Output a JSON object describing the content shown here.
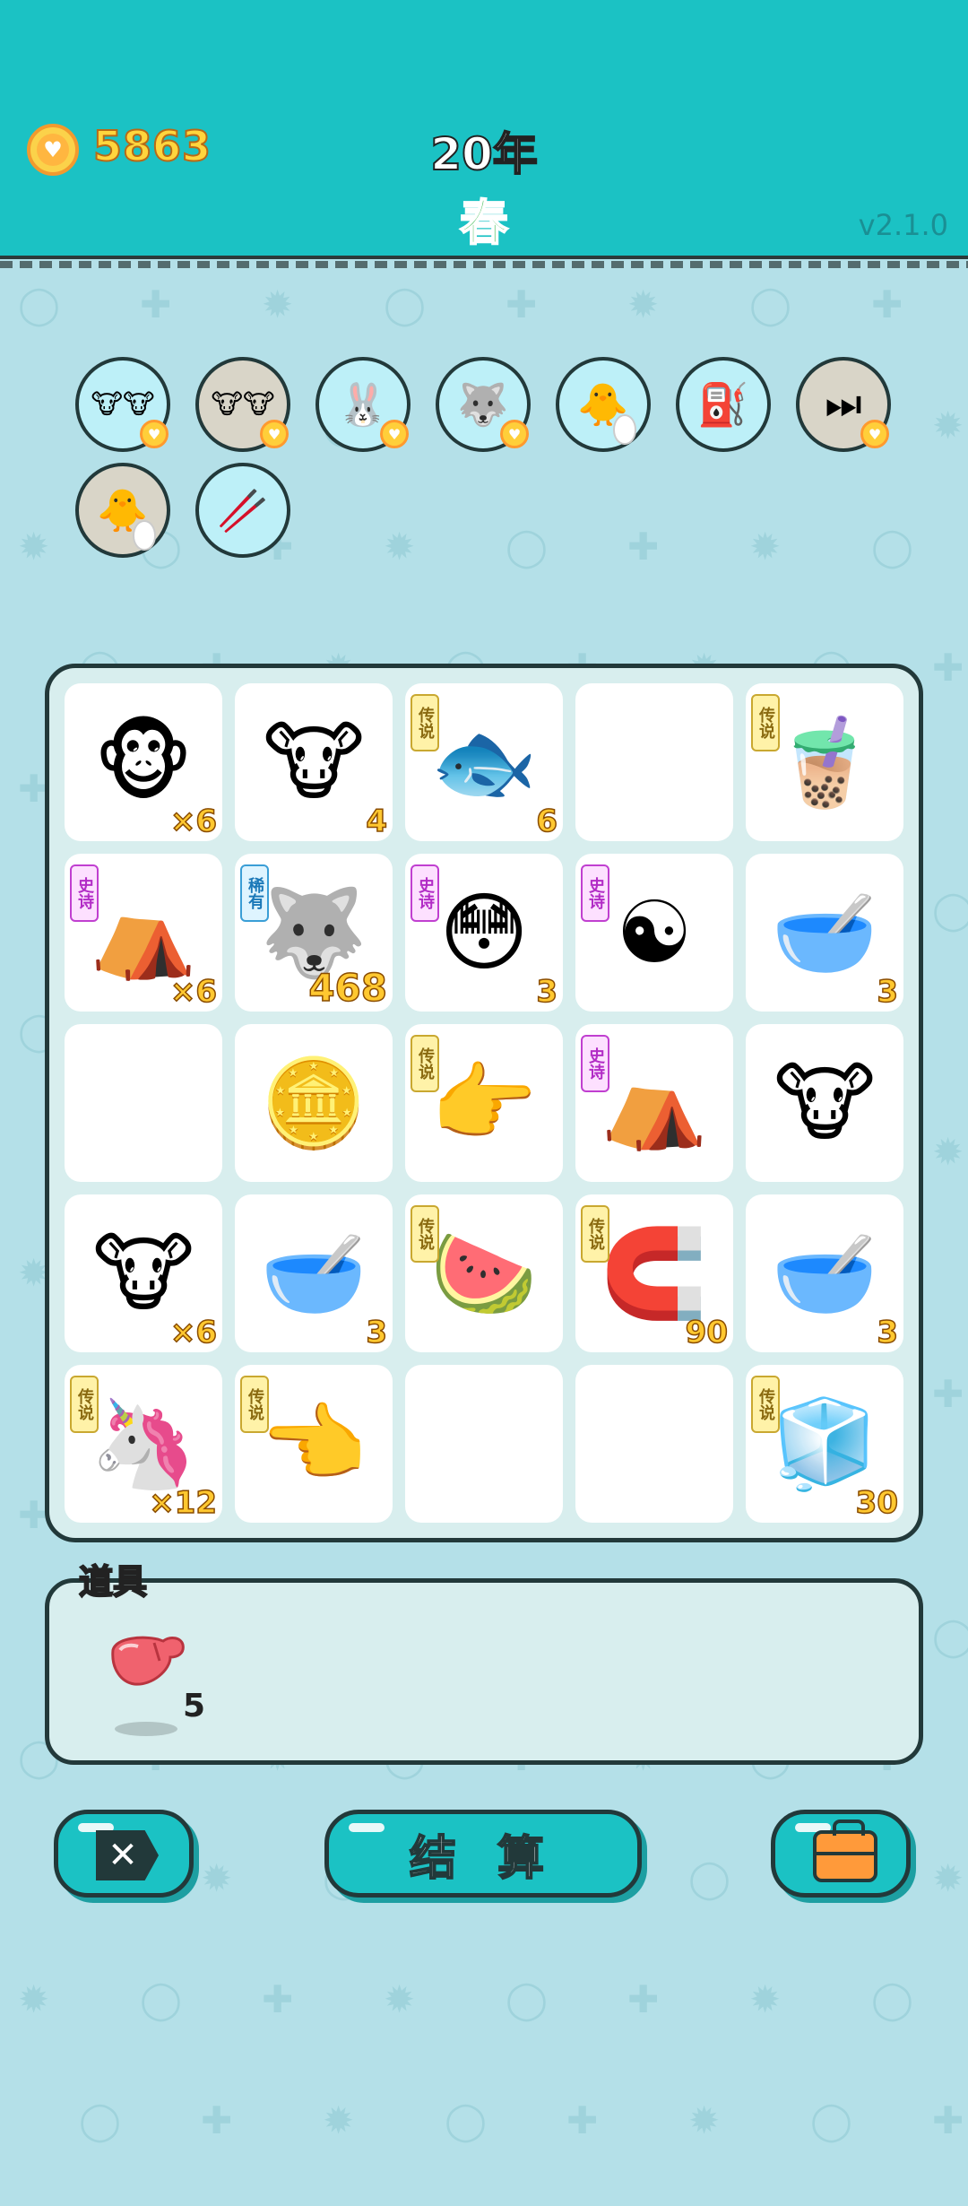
{
  "header": {
    "coins": "5863",
    "year": "20年",
    "season": "春",
    "version": "v2.1.0",
    "colors": {
      "bar": "#1bc2c4",
      "coin_text": "#ffd53d",
      "season_text": "#37b84a"
    }
  },
  "pets": [
    {
      "icon": "two-cows-icon",
      "glyph": "🐮🐮",
      "bg": "cyan",
      "badge": true
    },
    {
      "icon": "two-cows-icon",
      "glyph": "🐮🐮",
      "bg": "beige",
      "badge": true
    },
    {
      "icon": "rabbit-icon",
      "glyph": "🐰",
      "bg": "cyan",
      "badge": true
    },
    {
      "icon": "husky-icon",
      "glyph": "🐺",
      "bg": "cyan",
      "badge": true
    },
    {
      "icon": "chick-egg-icon",
      "glyph": "🐥",
      "bg": "cyan",
      "egg": true
    },
    {
      "icon": "air-pump-icon",
      "glyph": "⛽",
      "bg": "cyan"
    },
    {
      "icon": "skip-forward-icon",
      "glyph": "⏭",
      "bg": "beige",
      "badge": true
    },
    {
      "icon": "chick-egg-icon",
      "glyph": "🐥",
      "bg": "beige",
      "egg": true
    },
    {
      "icon": "chopsticks-icon",
      "glyph": "🥢",
      "bg": "cyan"
    }
  ],
  "board": [
    {
      "item": "monkey-icon",
      "glyph": "🐵",
      "count": "×6"
    },
    {
      "item": "cow-icon",
      "glyph": "🐮",
      "count": "4"
    },
    {
      "item": "koi-fish-icon",
      "glyph": "🐟",
      "tag": "传说",
      "tagType": "legend",
      "count": "6"
    },
    {
      "item": "empty"
    },
    {
      "item": "bubble-tea-icon",
      "glyph": "🧋",
      "tag": "传说",
      "tagType": "legend"
    },
    {
      "item": "rabbit-tent-icon",
      "glyph": "⛺",
      "tag": "史诗",
      "tagType": "epic",
      "count": "×6"
    },
    {
      "item": "husky-icon",
      "glyph": "🐺",
      "tag": "稀有",
      "tagType": "rare",
      "count": "468",
      "big": true
    },
    {
      "item": "yellow-face-icon",
      "glyph": "😳",
      "tag": "史诗",
      "tagType": "epic",
      "count": "3"
    },
    {
      "item": "bagua-icon",
      "glyph": "☯",
      "tag": "史诗",
      "tagType": "epic"
    },
    {
      "item": "soup-bowl-icon",
      "glyph": "🥣",
      "count": "3"
    },
    {
      "item": "empty"
    },
    {
      "item": "coins-pile-icon",
      "glyph": "🪙"
    },
    {
      "item": "pointing-hand-icon",
      "glyph": "👉",
      "tag": "传说",
      "tagType": "legend"
    },
    {
      "item": "rabbit-tent-icon",
      "glyph": "⛺",
      "tag": "史诗",
      "tagType": "epic"
    },
    {
      "item": "cow-icon",
      "glyph": "🐮"
    },
    {
      "item": "cow-icon",
      "glyph": "🐮",
      "count": "×6"
    },
    {
      "item": "soup-bowl-icon",
      "glyph": "🥣",
      "count": "3"
    },
    {
      "item": "watermelon-icon",
      "glyph": "🍉",
      "tag": "传说",
      "tagType": "legend"
    },
    {
      "item": "coin-magnet-icon",
      "glyph": "🧲",
      "tag": "传说",
      "tagType": "legend",
      "count": "90"
    },
    {
      "item": "soup-bowl-icon",
      "glyph": "🥣",
      "count": "3"
    },
    {
      "item": "unicorn-icon",
      "glyph": "🦄",
      "tag": "传说",
      "tagType": "legend",
      "count": "×12"
    },
    {
      "item": "pointing-hand-icon",
      "glyph": "👈",
      "tag": "传说",
      "tagType": "legend"
    },
    {
      "item": "empty"
    },
    {
      "item": "empty"
    },
    {
      "item": "fridge-icon",
      "glyph": "🧊",
      "tag": "传说",
      "tagType": "legend",
      "count": "30"
    }
  ],
  "props": {
    "label": "道具",
    "items": [
      {
        "icon": "liver-icon",
        "count": "5"
      }
    ]
  },
  "buttons": {
    "close_icon": "close-icon",
    "close_glyph": "✕",
    "settle_label": "结 算",
    "bag_icon": "briefcase-icon"
  }
}
